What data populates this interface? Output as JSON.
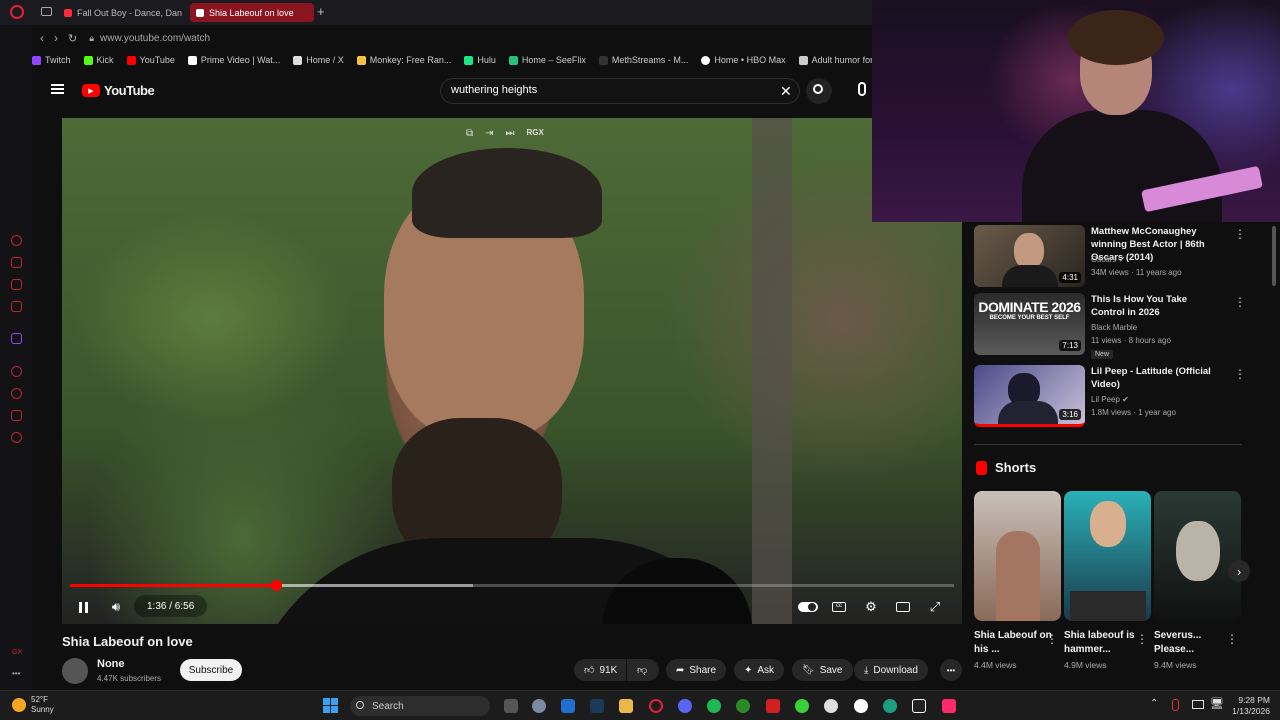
{
  "browser": {
    "tabs": [
      {
        "label": "Fall Out Boy - Dance, Dance",
        "active": false
      },
      {
        "label": "Shia Labeouf on love",
        "active": true
      }
    ],
    "url": "www.youtube.com/watch",
    "bookmarks": [
      {
        "label": "Twitch",
        "color": "#9146ff"
      },
      {
        "label": "Kick",
        "color": "#53fc18"
      },
      {
        "label": "YouTube",
        "color": "#ff0000"
      },
      {
        "label": "Prime Video | Wat...",
        "color": "#ffffff"
      },
      {
        "label": "Home / X",
        "color": "#dddddd"
      },
      {
        "label": "Monkey: Free Ran...",
        "color": "#f5c044"
      },
      {
        "label": "Hulu",
        "color": "#1ce783"
      },
      {
        "label": "Home – SeeFlix",
        "color": "#2bc07a"
      },
      {
        "label": "MethStreams - M...",
        "color": "#333333"
      },
      {
        "label": "Home • HBO Max",
        "color": "#ffffff"
      },
      {
        "label": "Adult humor for a...",
        "color": "#cccccc"
      }
    ]
  },
  "youtube": {
    "logo_text": "YouTube",
    "search_value": "wuthering heights",
    "video": {
      "time_current": "1:36",
      "time_total": "6:56",
      "time_display": "1:36 / 6:56",
      "progress": 0.233,
      "buffered": 0.456,
      "ext_label": "RGX"
    },
    "title": "Shia Labeouf on love",
    "channel": {
      "name": "None",
      "subscribers": "4.47K subscribers",
      "subscribe_label": "Subscribe"
    },
    "actions": {
      "likes": "91K",
      "share": "Share",
      "ask": "Ask",
      "save": "Save",
      "download": "Download",
      "more": "•••"
    },
    "recommendations": [
      {
        "title": "Matthew McConaughey winning Best Actor | 86th Oscars (2014)",
        "channel": "Oscars",
        "verified": true,
        "meta": "34M views · 11 years ago",
        "duration": "4:31",
        "new": false
      },
      {
        "title": "This Is How You Take Control in 2026",
        "channel": "Black Marble",
        "verified": false,
        "meta": "11 views · 8 hours ago",
        "duration": "7:13",
        "new": true,
        "new_label": "New",
        "thumb_text": "DOMINATE 2026",
        "thumb_sub": "BECOME YOUR BEST SELF"
      },
      {
        "title": "Lil Peep - Latitude (Official Video)",
        "channel": "Lil Peep",
        "verified": true,
        "meta": "1.8M views · 1 year ago",
        "duration": "3:16",
        "new": false
      }
    ],
    "shorts_heading": "Shorts",
    "shorts": [
      {
        "title": "Shia Labeouf on his ...",
        "views": "4.4M views"
      },
      {
        "title": "Shia labeouf is hammer...",
        "views": "4.9M views"
      },
      {
        "title": "Severus... Please...",
        "views": "9.4M views"
      }
    ]
  },
  "taskbar": {
    "weather_temp": "52°F",
    "weather_desc": "Sunny",
    "search_label": "Search",
    "time": "9:28 PM",
    "date": "1/13/2026"
  }
}
